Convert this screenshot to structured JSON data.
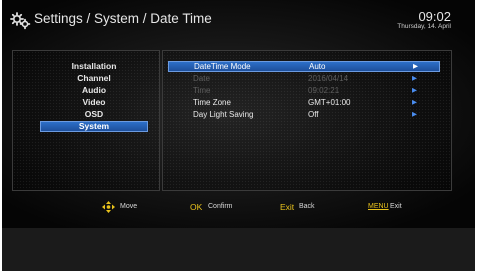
{
  "header": {
    "title": "Settings / System / Date Time",
    "time": "09:02",
    "date": "Thursday, 14. April"
  },
  "menu": {
    "items": [
      {
        "label": "Installation"
      },
      {
        "label": "Channel"
      },
      {
        "label": "Audio"
      },
      {
        "label": "Video"
      },
      {
        "label": "OSD"
      },
      {
        "label": "System"
      }
    ],
    "selected": "System"
  },
  "settings": {
    "rows": [
      {
        "label": "DateTime Mode",
        "value": "Auto",
        "state": "selected"
      },
      {
        "label": "Date",
        "value": "2016/04/14",
        "state": "disabled"
      },
      {
        "label": "Time",
        "value": "09:02:21",
        "state": "disabled"
      },
      {
        "label": "Time Zone",
        "value": "GMT+01:00",
        "state": "normal"
      },
      {
        "label": "Day Light Saving",
        "value": "Off",
        "state": "normal"
      }
    ],
    "arrow_glyph": "▶"
  },
  "footer": {
    "move": {
      "key_icon": "dpad-icon",
      "label": "Move"
    },
    "confirm": {
      "key": "OK",
      "label": "Confirm"
    },
    "back": {
      "key": "Exit",
      "label": "Back"
    },
    "exit": {
      "key": "MENU",
      "label": "Exit"
    }
  },
  "colors": {
    "highlight": "#2d6fc9",
    "key_yellow": "#e8c21c",
    "arrow_blue": "#4a8df0"
  }
}
